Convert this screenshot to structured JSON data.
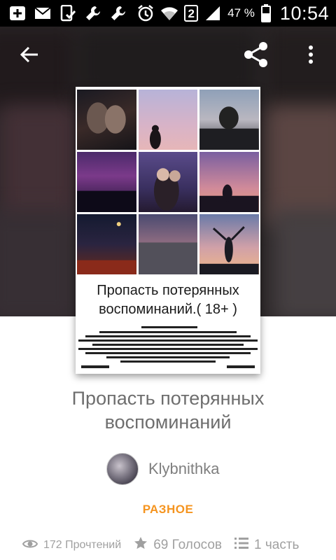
{
  "status_bar": {
    "icons": [
      "add-notification-icon",
      "mail-icon",
      "tablet-check-icon",
      "wrench-icon",
      "wrench-icon",
      "alarm-icon",
      "wifi-icon",
      "sim-2-icon",
      "signal-icon",
      "battery-icon"
    ],
    "sim_badge": "2",
    "battery_percent": "47 %",
    "time": "10:54"
  },
  "toolbar": {
    "back_icon": "arrow-back-icon",
    "share_icon": "share-icon",
    "more_icon": "more-vertical-icon"
  },
  "cover": {
    "title_line1": "Пропасть потерянных",
    "title_line2": "воспоминаний.( 18+ )"
  },
  "story": {
    "title": "Пропасть потерянных воспоминаний",
    "author": "Klybnithka",
    "category": "РАЗНОЕ"
  },
  "stats": {
    "reads": "172 Прочтений",
    "votes": "69 Голосов",
    "parts": "1 часть"
  },
  "colors": {
    "accent_category": "#f5941f",
    "title_text": "#6e6e6e",
    "stat_text": "#a0a0a0",
    "status_bar_bg": "#000000"
  }
}
